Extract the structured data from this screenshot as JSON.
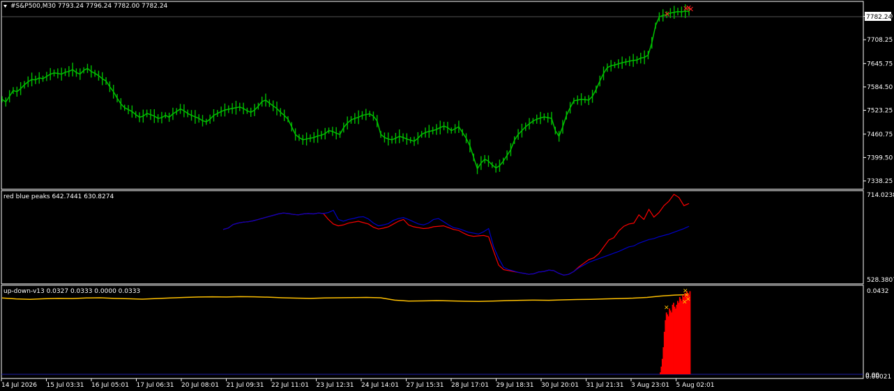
{
  "chart_data": [
    {
      "type": "line",
      "panel": "main",
      "title": "#S&P500,M30  7793.24 7796.24 7782.00 7782.24",
      "current_price": "7782.24",
      "y_ticks": [
        "7769.50",
        "7708.25",
        "7645.75",
        "7584.50",
        "7523.25",
        "7460.75",
        "7399.50",
        "7338.25"
      ],
      "ylim": [
        7320,
        7805
      ],
      "color": "#00c000",
      "series": [
        {
          "values": [
            7552,
            7545,
            7560,
            7575,
            7572,
            7580,
            7590,
            7598,
            7604,
            7603,
            7608,
            7606,
            7612,
            7618,
            7621,
            7620,
            7618,
            7623,
            7625,
            7630,
            7622,
            7618,
            7628,
            7633,
            7625,
            7620,
            7614,
            7606,
            7600,
            7585,
            7572,
            7555,
            7540,
            7530,
            7525,
            7520,
            7512,
            7505,
            7508,
            7515,
            7512,
            7508,
            7502,
            7504,
            7510,
            7505,
            7514,
            7520,
            7527,
            7522,
            7515,
            7510,
            7506,
            7502,
            7496,
            7493,
            7500,
            7510,
            7515,
            7520,
            7524,
            7526,
            7528,
            7530,
            7532,
            7528,
            7522,
            7518,
            7524,
            7534,
            7546,
            7550,
            7542,
            7535,
            7528,
            7518,
            7510,
            7500,
            7480,
            7460,
            7452,
            7446,
            7448,
            7450,
            7452,
            7456,
            7458,
            7462,
            7470,
            7468,
            7463,
            7460,
            7478,
            7490,
            7498,
            7502,
            7505,
            7510,
            7512,
            7514,
            7508,
            7495,
            7460,
            7452,
            7448,
            7446,
            7450,
            7455,
            7452,
            7448,
            7445,
            7442,
            7450,
            7460,
            7465,
            7468,
            7470,
            7473,
            7478,
            7482,
            7478,
            7470,
            7475,
            7480,
            7465,
            7450,
            7430,
            7400,
            7370,
            7385,
            7395,
            7390,
            7380,
            7372,
            7378,
            7390,
            7405,
            7420,
            7445,
            7460,
            7470,
            7480,
            7488,
            7495,
            7500,
            7503,
            7506,
            7504,
            7502,
            7470,
            7455,
            7480,
            7510,
            7530,
            7548,
            7550,
            7552,
            7551,
            7550,
            7560,
            7578,
            7600,
            7620,
            7635,
            7640,
            7642,
            7645,
            7648,
            7650,
            7652,
            7654,
            7655,
            7660,
            7662,
            7668,
            7700,
            7745,
            7768,
            7772,
            7774,
            7778,
            7780,
            7782,
            7781,
            7783,
            7782
          ]
        }
      ]
    },
    {
      "type": "line",
      "panel": "indicator-1",
      "title": "red blue peaks 642.7441 630.8274",
      "y_ticks": [
        "714.0238",
        "528.3807"
      ],
      "ylim": [
        522,
        720
      ],
      "series": [
        {
          "color": "#ff0000",
          "values": [
            638,
            641,
            649,
            652,
            654,
            655,
            657,
            660,
            663,
            666,
            669,
            672,
            674,
            673,
            671,
            670,
            672,
            673,
            672,
            674,
            673,
            660,
            650,
            646,
            648,
            652,
            654,
            656,
            653,
            650,
            643,
            639,
            641,
            644,
            650,
            656,
            660,
            648,
            644,
            642,
            640,
            641,
            644,
            645,
            646,
            642,
            638,
            636,
            630,
            625,
            623,
            624,
            625,
            622,
            590,
            560,
            550,
            548,
            546,
            544,
            542,
            540,
            541,
            545,
            546,
            549,
            548,
            542,
            538,
            540,
            546,
            556,
            564,
            572,
            576,
            585,
            600,
            615,
            620,
            635,
            645,
            650,
            652,
            670,
            660,
            682,
            665,
            675,
            690,
            700,
            715,
            708,
            690,
            695
          ]
        },
        {
          "color": "#0000cc",
          "values": [
            638,
            641,
            649,
            652,
            654,
            655,
            657,
            660,
            663,
            666,
            669,
            672,
            674,
            673,
            671,
            670,
            672,
            673,
            672,
            674,
            673,
            675,
            680,
            660,
            656,
            660,
            662,
            665,
            666,
            661,
            652,
            646,
            648,
            651,
            658,
            662,
            664,
            660,
            655,
            650,
            648,
            652,
            660,
            662,
            655,
            648,
            642,
            640,
            636,
            632,
            630,
            628,
            633,
            640,
            600,
            575,
            555,
            550,
            547,
            544,
            542,
            540,
            541,
            545,
            546,
            549,
            548,
            542,
            538,
            540,
            546,
            554,
            560,
            566,
            570,
            574,
            578,
            582,
            586,
            590,
            595,
            600,
            602,
            608,
            612,
            616,
            618,
            622,
            625,
            628,
            632,
            636,
            640,
            645
          ]
        }
      ]
    },
    {
      "type": "area",
      "panel": "indicator-2",
      "title": "up-down-v13 0.0327 0.0333 0.0000 0.0333",
      "y_ticks": [
        "0.0432",
        "0.00"
      ],
      "ylim": [
        0,
        0.045
      ],
      "series": [
        {
          "color": "#ffc000",
          "kind": "line",
          "values": [
            0.0395,
            0.039,
            0.0388,
            0.0391,
            0.0393,
            0.0392,
            0.0395,
            0.0396,
            0.0393,
            0.0391,
            0.0389,
            0.0392,
            0.0395,
            0.0398,
            0.04,
            0.0401,
            0.04,
            0.0402,
            0.0401,
            0.0399,
            0.0396,
            0.0394,
            0.0393,
            0.0395,
            0.0396,
            0.0397,
            0.0398,
            0.0396,
            0.0384,
            0.0379,
            0.038,
            0.0381,
            0.038,
            0.0378,
            0.0377,
            0.0379,
            0.0381,
            0.0383,
            0.0384,
            0.0383,
            0.0385,
            0.0387,
            0.0388,
            0.039,
            0.0392,
            0.0394,
            0.0398,
            0.0405,
            0.041,
            0.0412
          ]
        },
        {
          "color": "#ff0000",
          "kind": "histogram",
          "values": [
            0.001,
            0.004,
            0.008,
            0.014,
            0.022,
            0.028,
            0.032,
            0.031,
            0.03,
            0.034,
            0.033,
            0.032,
            0.036,
            0.037,
            0.035,
            0.034,
            0.036,
            0.038,
            0.037,
            0.04,
            0.039,
            0.038,
            0.041,
            0.04,
            0.042,
            0.041,
            0.043,
            0.042,
            0.041,
            0.043
          ]
        }
      ]
    }
  ],
  "time_axis": {
    "labels": [
      "14 Jul 2026",
      "15 Jul 03:31",
      "16 Jul 05:01",
      "17 Jul 06:31",
      "20 Jul 08:01",
      "21 Jul 09:31",
      "22 Jul 11:01",
      "23 Jul 12:31",
      "24 Jul 14:01",
      "27 Jul 15:31",
      "28 Jul 17:01",
      "29 Jul 18:31",
      "30 Jul 20:01",
      "31 Jul 21:31",
      "3 Aug 23:01",
      "5 Aug 02:01"
    ]
  },
  "right_bottom_label": "0.00021",
  "colors": {
    "background": "#000000",
    "frame": "#ffffff",
    "price_line": "#00c000",
    "marker": "#ff0000"
  }
}
